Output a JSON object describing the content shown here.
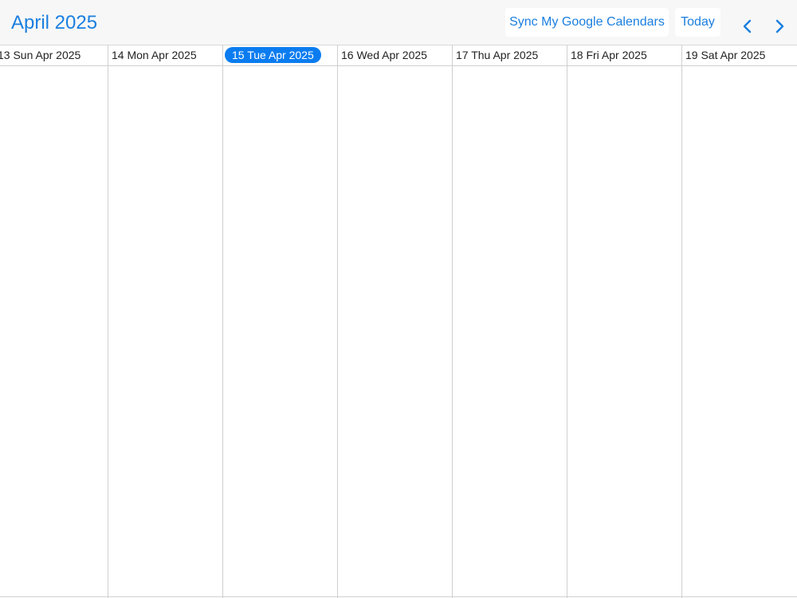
{
  "header": {
    "title": "April 2025",
    "sync_label": "Sync My Google Calendars",
    "today_label": "Today",
    "prev_icon": "chevron-left-icon",
    "next_icon": "chevron-right-icon"
  },
  "week": {
    "days": [
      {
        "label": "13 Sun Apr 2025",
        "is_today": false
      },
      {
        "label": "14 Mon Apr 2025",
        "is_today": false
      },
      {
        "label": "15 Tue Apr 2025",
        "is_today": true
      },
      {
        "label": "16 Wed Apr 2025",
        "is_today": false
      },
      {
        "label": "17 Thu Apr 2025",
        "is_today": false
      },
      {
        "label": "18 Fri Apr 2025",
        "is_today": false
      },
      {
        "label": "19 Sat Apr 2025",
        "is_today": false
      }
    ]
  },
  "colors": {
    "accent": "#1a7fe0",
    "today_pill": "#0a7cf0",
    "header_bg": "#f7f7f7",
    "grid_line": "#cfcfcf"
  }
}
